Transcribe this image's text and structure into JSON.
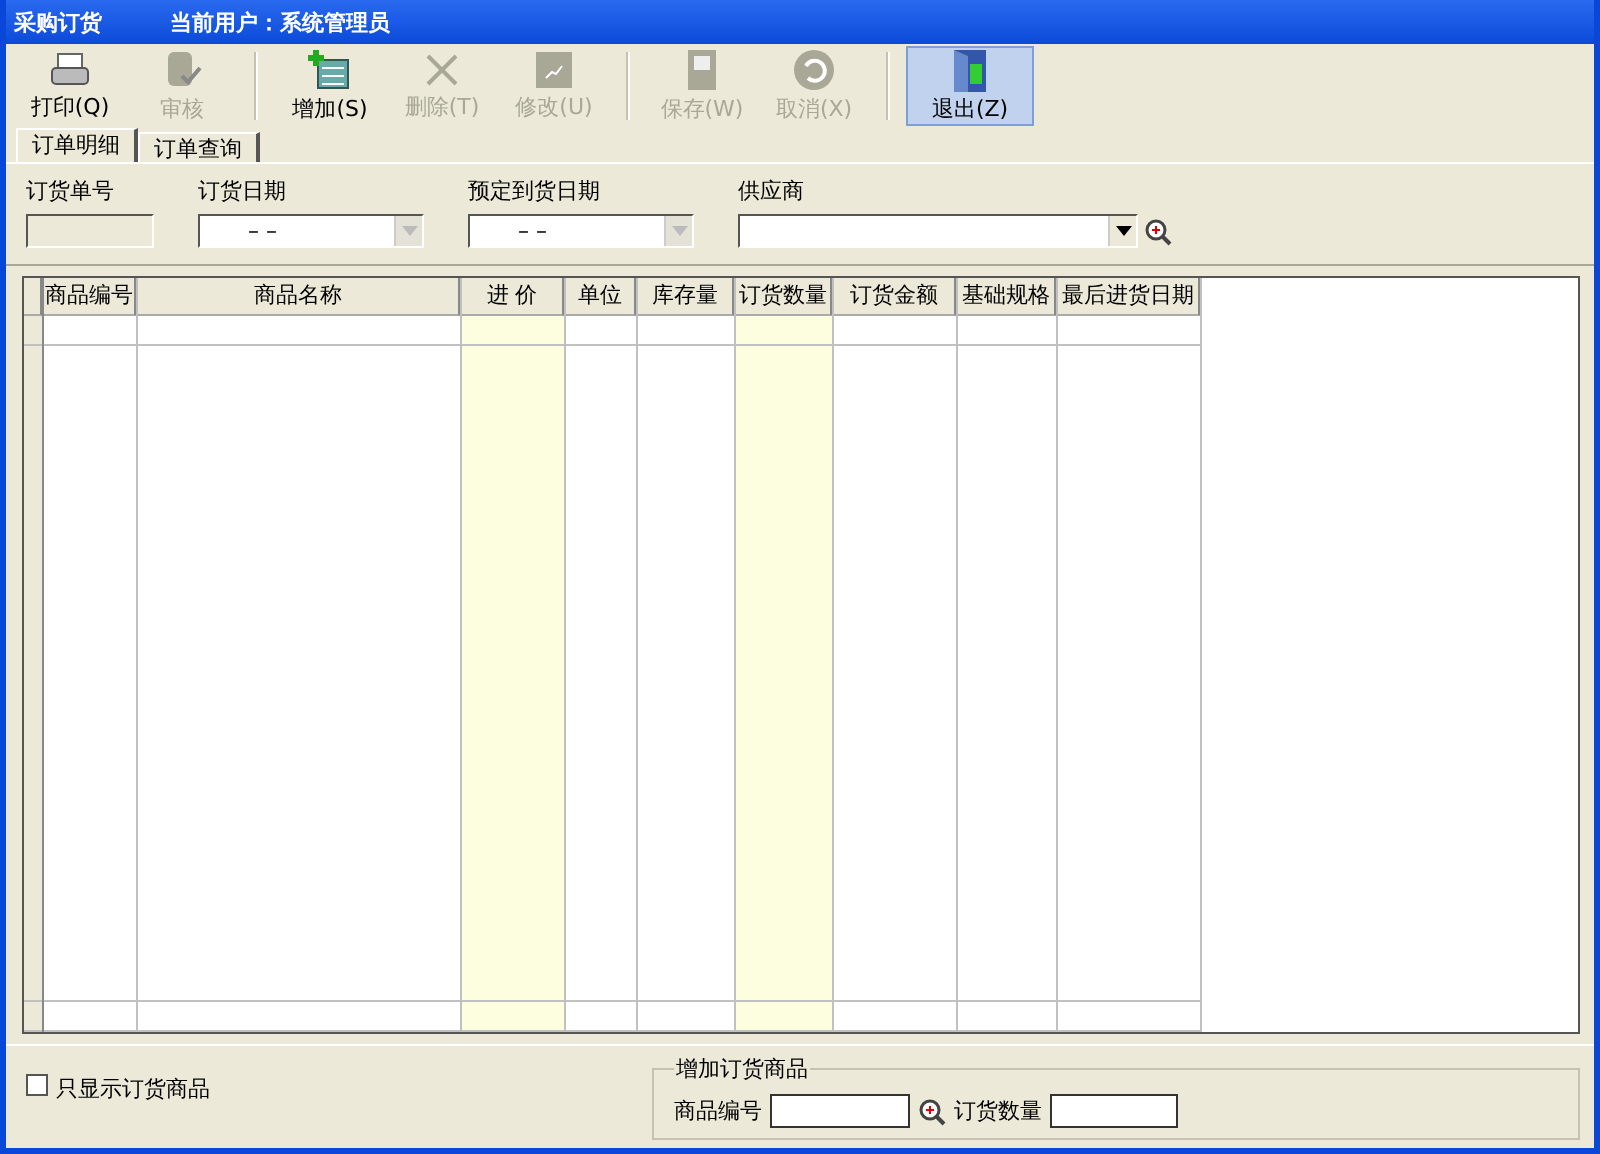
{
  "window": {
    "title": "采购订货",
    "user": "当前用户：系统管理员"
  },
  "toolbar": [
    {
      "kind": "print",
      "label": "打印(Q)",
      "disabled": false,
      "selected": false
    },
    {
      "kind": "audit",
      "label": "审核",
      "disabled": true,
      "selected": false
    },
    {
      "kind": "add",
      "label": "增加(S)",
      "disabled": false,
      "selected": false,
      "separator_before": true
    },
    {
      "kind": "delete",
      "label": "删除(T)",
      "disabled": true,
      "selected": false
    },
    {
      "kind": "edit",
      "label": "修改(U)",
      "disabled": true,
      "selected": false
    },
    {
      "kind": "save",
      "label": "保存(W)",
      "disabled": true,
      "selected": false,
      "separator_before": true
    },
    {
      "kind": "cancel",
      "label": "取消(X)",
      "disabled": true,
      "selected": false
    },
    {
      "kind": "exit",
      "label": "退出(Z)",
      "disabled": false,
      "selected": true,
      "separator_before": true
    }
  ],
  "tabs": [
    {
      "label": "订单明细",
      "selected": true
    },
    {
      "label": "订单查询",
      "selected": false
    }
  ],
  "filters": [
    {
      "kind": "text",
      "label": "订货单号",
      "disabled": true
    },
    {
      "kind": "date",
      "label": "订货日期",
      "value": "–  –"
    },
    {
      "kind": "date",
      "label": "预定到货日期",
      "value": "–  –"
    },
    {
      "kind": "combo",
      "label": "供应商"
    }
  ],
  "table": {
    "columns": [
      {
        "label": "商品编号",
        "highlighted": false
      },
      {
        "label": "商品名称",
        "highlighted": false
      },
      {
        "label": "进  价",
        "highlighted": true
      },
      {
        "label": "单位",
        "highlighted": false
      },
      {
        "label": "库存量",
        "highlighted": false
      },
      {
        "label": "订货数量",
        "highlighted": true
      },
      {
        "label": "订货金额",
        "highlighted": false
      },
      {
        "label": "基础规格",
        "highlighted": false
      },
      {
        "label": "最后进货日期",
        "highlighted": false
      }
    ]
  },
  "only_ordered": {
    "label": "只显示订货商品",
    "checked": false
  },
  "add_group": {
    "title": "增加订货商品",
    "code_label": "商品编号",
    "qty_label": "订货数量"
  }
}
